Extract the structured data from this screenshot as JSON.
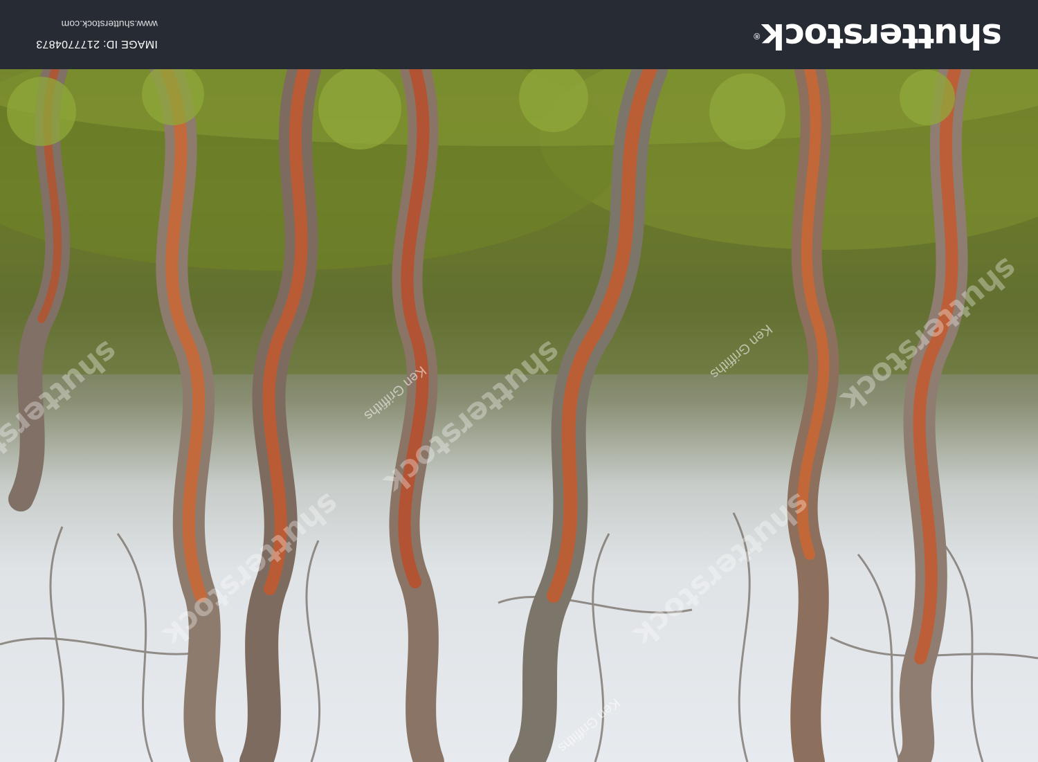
{
  "footer": {
    "logo_text": "shutterstock",
    "registered_mark": "®",
    "image_id": "IMAGE ID: 2177704873",
    "site_url": "www.shutterstock.com"
  },
  "watermark": {
    "brand": "shutterstock",
    "author": "Ken Griffiths"
  },
  "photo": {
    "subject": "twisted multicoloured snow gum trunks in misty forest, image upside-down",
    "colors": {
      "sky": "#e3e6e9",
      "moss": "#6b7b2b",
      "bark_orange": "#c8582a",
      "bark_grey": "#8a8178",
      "bar": "#272c34"
    }
  }
}
